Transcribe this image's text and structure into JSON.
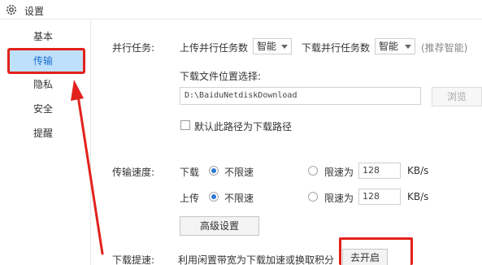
{
  "window": {
    "title": "设置",
    "icon": "gear-icon"
  },
  "sidebar": {
    "items": [
      {
        "label": "基本",
        "active": false
      },
      {
        "label": "传输",
        "active": true
      },
      {
        "label": "隐私",
        "active": false
      },
      {
        "label": "安全",
        "active": false
      },
      {
        "label": "提醒",
        "active": false
      }
    ]
  },
  "parallel_tasks": {
    "label": "并行任务:",
    "upload_label": "上传并行任务数",
    "upload_value": "智能",
    "download_label": "下载并行任务数",
    "download_value": "智能",
    "hint": "(推荐智能)"
  },
  "download_location": {
    "label": "下载文件位置选择:",
    "path": "D:\\BaiduNetdiskDownload",
    "browse_label": "浏览",
    "default_checkbox_label": "默认此路径为下载路径",
    "default_checked": false
  },
  "transfer_speed": {
    "label": "传输速度:",
    "download": {
      "label": "下载",
      "unlimited_label": "不限速",
      "limit_label": "限速为",
      "limit_value": "128",
      "unit": "KB/s",
      "selected": "unlimited"
    },
    "upload": {
      "label": "上传",
      "unlimited_label": "不限速",
      "limit_label": "限速为",
      "limit_value": "128",
      "unit": "KB/s",
      "selected": "unlimited"
    },
    "advanced_button": "高级设置"
  },
  "download_boost": {
    "label": "下载提速:",
    "description": "利用闲置带宽为下载加速或换取积分",
    "enable_button": "去开启"
  },
  "annotation_color": "#e2211c"
}
